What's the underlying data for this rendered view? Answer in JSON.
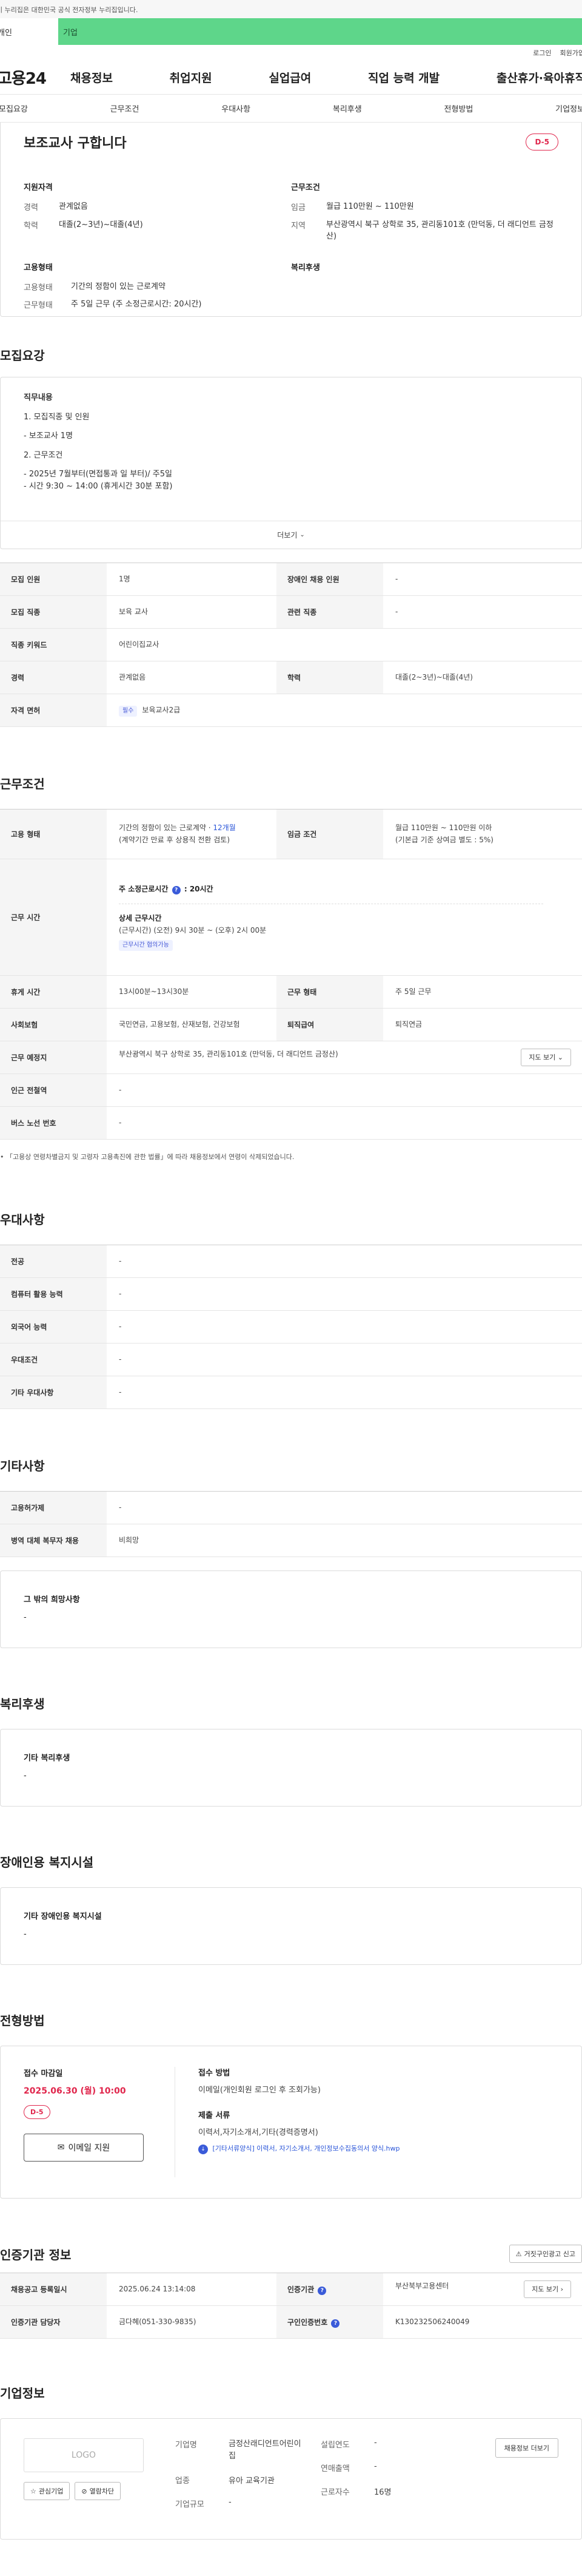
{
  "gov_banner": "이 누리집은 대한민국 공식 전자정부 누리집입니다.",
  "service_tabs": [
    {
      "label": "개인"
    },
    {
      "label": "기업"
    }
  ],
  "util_links": [
    {
      "label": "로그인"
    },
    {
      "label": "회원가입"
    }
  ],
  "logo": "고용24",
  "gnb": [
    {
      "label": "채용정보"
    },
    {
      "label": "취업지원"
    },
    {
      "label": "실업급여"
    },
    {
      "label": "직업 능력 개발"
    },
    {
      "label": "출산휴가·육아휴직"
    }
  ],
  "anchors": [
    {
      "label": "모집요강"
    },
    {
      "label": "근무조건"
    },
    {
      "label": "우대사항"
    },
    {
      "label": "복리후생"
    },
    {
      "label": "전형방법"
    },
    {
      "label": "기업정보"
    }
  ],
  "summary": {
    "title": "보조교사 구합니다",
    "dday": "D-5",
    "qual_heading": "지원자격",
    "qual": [
      {
        "k": "경력",
        "v": "관계없음"
      },
      {
        "k": "학력",
        "v": "대졸(2~3년)~대졸(4년)"
      }
    ],
    "cond_heading": "근무조건",
    "cond": [
      {
        "k": "임금",
        "v": "월급 110만원 ~ 110만원"
      },
      {
        "k": "지역",
        "v": "부산광역시 북구 상학로 35, 관리동101호 (만덕동, 더 래디언트 금정산)"
      }
    ],
    "emp_heading": "고용형태",
    "emp": [
      {
        "k": "고용형태",
        "v": "기간의 정함이 있는 근로계약"
      },
      {
        "k": "근무형태",
        "v": "주 5일 근무 (주 소정근로시간: 20시간)"
      }
    ],
    "welfare_heading": "복리후생"
  },
  "recruit": {
    "title": "모집요강",
    "content_heading": "직무내용",
    "content_lines": [
      "1. 모집직종 및 인원",
      "- 보조교사 1명",
      "2. 근무조건",
      "- 2025년 7월부터(면접통과 일 부터)/ 주5일",
      "- 시간 9:30 ~ 14:00 (휴게시간 30분 포함)"
    ],
    "more": "더보기",
    "table": {
      "recruit_count_k": "모집 인원",
      "recruit_count_v": "1명",
      "disabled_k": "장애인 채용 인원",
      "disabled_v": "-",
      "job_k": "모집 직종",
      "job_v": "보육 교사",
      "related_k": "관련 직종",
      "related_v": "-",
      "keyword_k": "직종 키워드",
      "keyword_v": "어린이집교사",
      "career_k": "경력",
      "career_v": "관계없음",
      "edu_k": "학력",
      "edu_v": "대졸(2~3년)~대졸(4년)",
      "license_k": "자격 면허",
      "license_badge": "필수",
      "license_v": "보육교사2급"
    }
  },
  "work": {
    "title": "근무조건",
    "emp_type_k": "고용 형태",
    "emp_type_v1": "기간의 정함이 있는 근로계약 ·",
    "emp_type_months": "12개월",
    "emp_type_v2": "(계약기간 만료 후 상용직 전환 검토)",
    "wage_k": "임금 조건",
    "wage_v1": "월급 110만원 ~ 110만원 이하",
    "wage_v2": "(기본급 기준 상여금 별도 : 5%)",
    "hours_k": "근무 시간",
    "hours_weekly_label": "주 소정근로시간",
    "hours_weekly_v": ": 20시간",
    "hours_detail_heading": "상세 근무시간",
    "hours_detail_v": "(근무시간) (오전) 9시 30분 ~ (오후) 2시 00분",
    "hours_badge": "근무시간 협의가능",
    "break_k": "휴게 시간",
    "break_v": "13시00분~13시30분",
    "work_form_k": "근무 형태",
    "work_form_v": "주 5일 근무",
    "insurance_k": "사회보험",
    "insurance_v": "국민연금, 고용보험, 산재보험, 건강보험",
    "severance_k": "퇴직급여",
    "severance_v": "퇴직연금",
    "place_k": "근무 예정지",
    "place_v": "부산광역시 북구 상학로 35, 관리동101호 (만덕동, 더 래디언트 금정산)",
    "map_btn": "지도 보기",
    "subway_k": "인근 전철역",
    "subway_v": "-",
    "bus_k": "버스 노선 번호",
    "bus_v": "-",
    "note": "「고용상 연령차별금지 및 고령자 고용촉진에 관한 법률」에 따라 채용정보에서 연령이 삭제되었습니다."
  },
  "pref": {
    "title": "우대사항",
    "rows": [
      {
        "k": "전공",
        "v": "-"
      },
      {
        "k": "컴퓨터 활용 능력",
        "v": "-"
      },
      {
        "k": "외국어 능력",
        "v": "-"
      },
      {
        "k": "우대조건",
        "v": "-"
      },
      {
        "k": "기타 우대사항",
        "v": "-"
      }
    ]
  },
  "etc": {
    "title": "기타사항",
    "rows": [
      {
        "k": "고용허가제",
        "v": "-"
      },
      {
        "k": "병역 대체 복무자 채용",
        "v": "비희망"
      }
    ],
    "box_heading": "그 밖의 희망사항",
    "box_v": "-"
  },
  "welfare": {
    "title": "복리후생",
    "heading": "기타 복리후생",
    "v": "-"
  },
  "disabled": {
    "title": "장애인용 복지시설",
    "heading": "기타 장애인용 복지시설",
    "v": "-"
  },
  "selection": {
    "title": "전형방법",
    "deadline_label": "접수 마감일",
    "deadline": "2025.06.30 (월) 10:00",
    "dday": "D-5",
    "apply_btn": "이메일 지원",
    "method_label": "접수 방법",
    "method_v": "이메일(개인회원 로그인 후 조회가능)",
    "docs_label": "제출 서류",
    "docs_v": "이력서,자기소개서,기타(경력증명서)",
    "attach": "[기타서류양식] 이력서, 자기소개서, 개인정보수집동의서 양식.hwp"
  },
  "cert": {
    "title": "인증기관 정보",
    "report_btn": "거짓구인광고 신고",
    "reg_k": "채용공고 등록일시",
    "reg_v": "2025.06.24 13:14:08",
    "org_k": "인증기관",
    "org_v": "부산북부고용센터",
    "map_btn": "지도 보기",
    "manager_k": "인증기관 담당자",
    "manager_v": "금다혜(051-330-9835)",
    "num_k": "구인인증번호",
    "num_v": "K130232506240049"
  },
  "corp": {
    "title": "기업정보",
    "logo_text": "LOGO",
    "fav_btn": "관심기업",
    "block_btn": "열람차단",
    "name_k": "기업명",
    "name_v": "금정산래디언트어린이집",
    "industry_k": "업종",
    "industry_v": "유아 교육기관",
    "size_k": "기업규모",
    "size_v": "-",
    "est_k": "설립연도",
    "est_v": "-",
    "sales_k": "연매출액",
    "sales_v": "-",
    "staff_k": "근로자수",
    "staff_v": "16명",
    "recruit_btn": "채용정보 더보기"
  }
}
